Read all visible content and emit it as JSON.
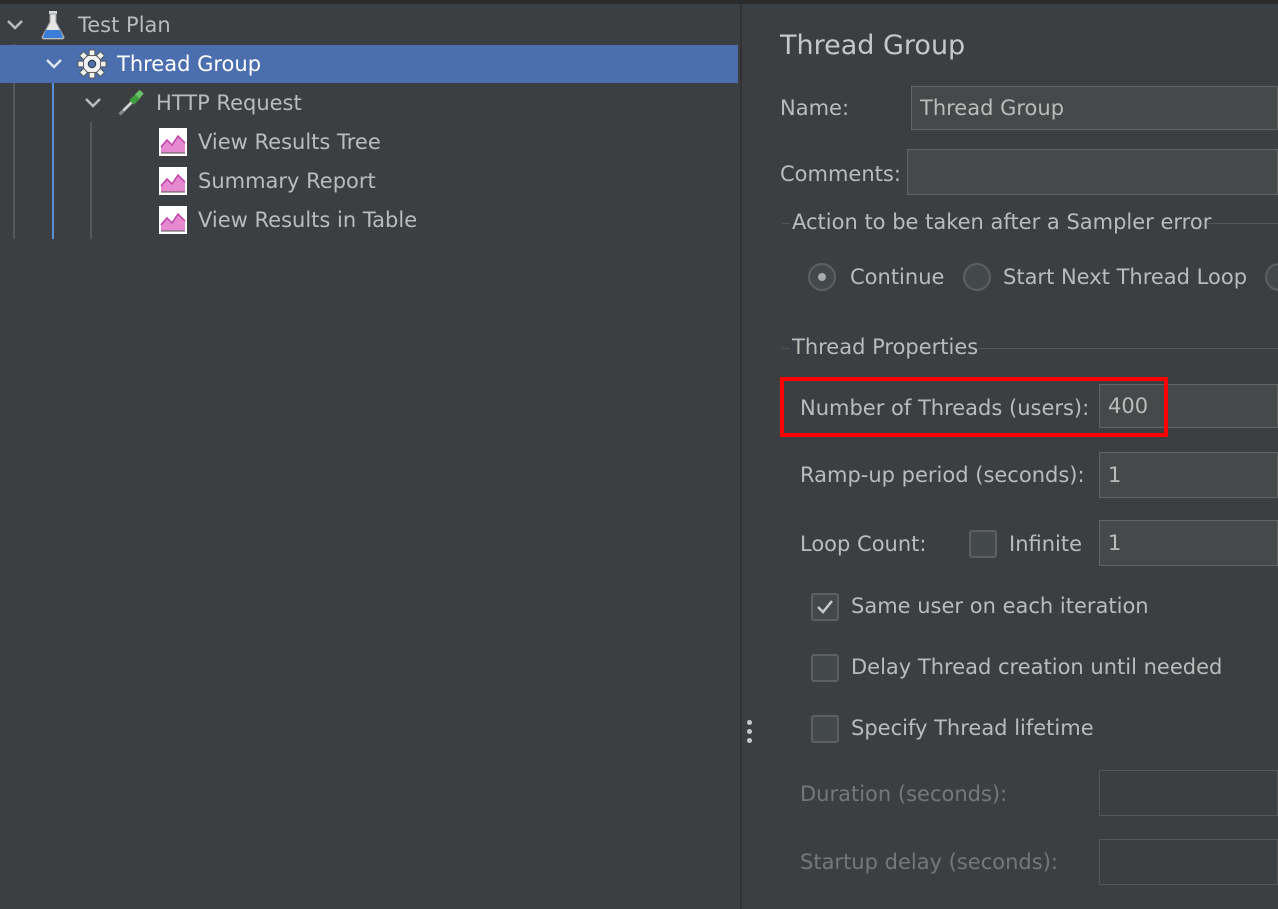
{
  "tree": {
    "items": [
      {
        "label": "Test Plan",
        "icon": "flask-icon"
      },
      {
        "label": "Thread Group",
        "icon": "gear-icon"
      },
      {
        "label": "HTTP Request",
        "icon": "pipette-icon"
      },
      {
        "label": "View Results Tree",
        "icon": "chart-listener-icon"
      },
      {
        "label": "Summary Report",
        "icon": "chart-listener-icon"
      },
      {
        "label": "View Results in Table",
        "icon": "chart-listener-icon"
      }
    ],
    "selected": "Thread Group"
  },
  "panel": {
    "title": "Thread Group",
    "name_label": "Name:",
    "name_value": "Thread Group",
    "comments_label": "Comments:",
    "comments_value": "",
    "sampler_error": {
      "legend": "Action to be taken after a Sampler error",
      "options": [
        "Continue",
        "Start Next Thread Loop"
      ],
      "selected": "Continue"
    },
    "thread_properties": {
      "legend": "Thread Properties",
      "num_threads_label": "Number of Threads (users):",
      "num_threads_value": "400",
      "rampup_label": "Ramp-up period (seconds):",
      "rampup_value": "1",
      "loop_label": "Loop Count:",
      "infinite_label": "Infinite",
      "infinite_checked": false,
      "loop_value": "1",
      "same_user_label": "Same user on each iteration",
      "same_user_checked": true,
      "delay_label": "Delay Thread creation until needed",
      "delay_checked": false,
      "lifetime_label": "Specify Thread lifetime",
      "lifetime_checked": false,
      "duration_label": "Duration (seconds):",
      "duration_value": "",
      "startup_label": "Startup delay (seconds):",
      "startup_value": ""
    }
  },
  "colors": {
    "background": "#3c3f41",
    "selection": "#4b6eaf",
    "highlight_box": "#ff0000"
  }
}
